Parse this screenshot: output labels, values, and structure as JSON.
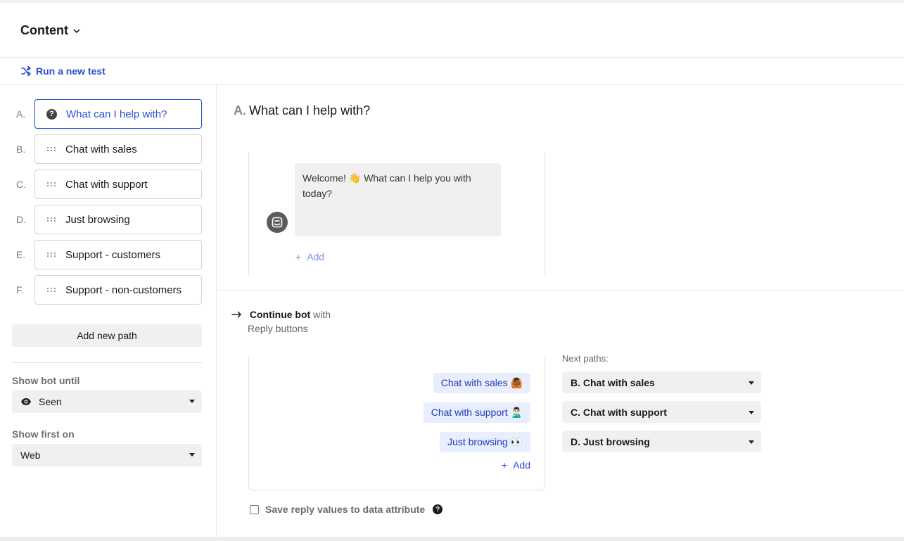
{
  "header": {
    "title": "Content"
  },
  "testbar": {
    "run_test_label": "Run a new test"
  },
  "paths": [
    {
      "letter": "A.",
      "label": "What can I help with?",
      "icon": "question-icon",
      "active": true
    },
    {
      "letter": "B.",
      "label": "Chat with sales",
      "icon": "drag-handle-icon"
    },
    {
      "letter": "C.",
      "label": "Chat with support",
      "icon": "drag-handle-icon"
    },
    {
      "letter": "D.",
      "label": "Just browsing",
      "icon": "drag-handle-icon"
    },
    {
      "letter": "E.",
      "label": "Support - customers",
      "icon": "drag-handle-icon"
    },
    {
      "letter": "F.",
      "label": "Support - non-customers",
      "icon": "drag-handle-icon"
    }
  ],
  "sidebar": {
    "add_path_label": "Add new path",
    "show_until_label": "Show bot until",
    "show_until_value": "Seen",
    "show_first_label": "Show first on",
    "show_first_value": "Web"
  },
  "step": {
    "letter": "A.",
    "title": "What can I help with?",
    "message": "Welcome! 👋  What can I help you with today?",
    "add_label": "Add"
  },
  "continue": {
    "action": "Continue bot",
    "with": "with",
    "mode": "Reply buttons"
  },
  "replies": [
    {
      "label": "Chat with sales 🙆🏾"
    },
    {
      "label": "Chat with support 🙎🏻‍♂️"
    },
    {
      "label": "Just browsing 👀"
    }
  ],
  "reply_add_label": "Add",
  "next_paths": {
    "label": "Next paths:",
    "options": [
      "B. Chat with sales",
      "C. Chat with support",
      "D. Just browsing"
    ]
  },
  "save": {
    "label": "Save reply values to data attribute"
  },
  "colors": {
    "accent": "#2b4fd8",
    "reply_bg": "#e9eefe",
    "panel_bg": "#f0f0f0"
  }
}
